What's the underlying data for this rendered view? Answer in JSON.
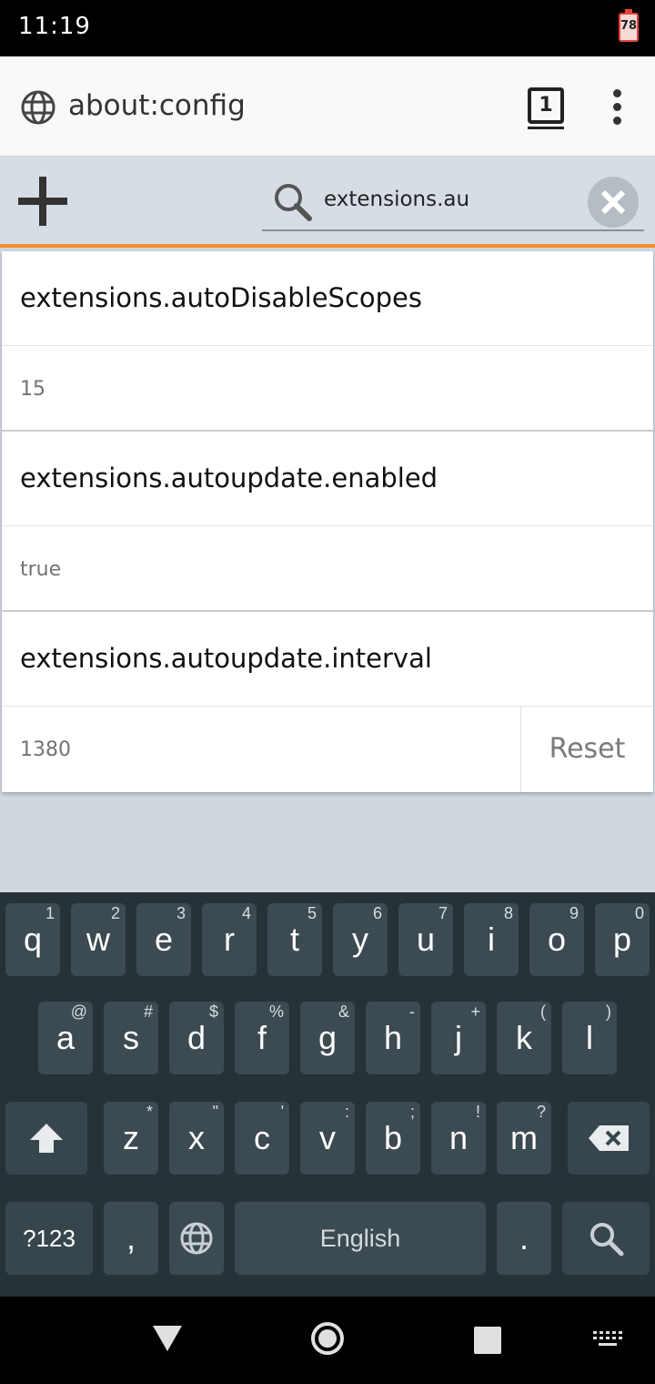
{
  "status_bar": {
    "time": "11:19",
    "battery": "78"
  },
  "browser": {
    "url": "about:config",
    "tab_count": "1",
    "icons": {
      "site": "globe-icon",
      "menu": "overflow-menu-icon"
    }
  },
  "toolbar": {
    "search_query": "extensions.au",
    "icons": {
      "add": "plus-icon",
      "search": "search-icon",
      "clear": "close-icon"
    }
  },
  "prefs": [
    {
      "name": "extensions.autoDisableScopes",
      "value": "15"
    },
    {
      "name": "extensions.autoupdate.enabled",
      "value": "true"
    },
    {
      "name": "extensions.autoupdate.interval",
      "value": "1380",
      "action": "Reset"
    }
  ],
  "keyboard": {
    "row1": [
      {
        "k": "q",
        "h": "1"
      },
      {
        "k": "w",
        "h": "2"
      },
      {
        "k": "e",
        "h": "3"
      },
      {
        "k": "r",
        "h": "4"
      },
      {
        "k": "t",
        "h": "5"
      },
      {
        "k": "y",
        "h": "6"
      },
      {
        "k": "u",
        "h": "7"
      },
      {
        "k": "i",
        "h": "8"
      },
      {
        "k": "o",
        "h": "9"
      },
      {
        "k": "p",
        "h": "0"
      }
    ],
    "row2": [
      {
        "k": "a",
        "h": "@"
      },
      {
        "k": "s",
        "h": "#"
      },
      {
        "k": "d",
        "h": "$"
      },
      {
        "k": "f",
        "h": "%"
      },
      {
        "k": "g",
        "h": "&"
      },
      {
        "k": "h",
        "h": "-"
      },
      {
        "k": "j",
        "h": "+"
      },
      {
        "k": "k",
        "h": "("
      },
      {
        "k": "l",
        "h": ")"
      }
    ],
    "row3": [
      {
        "k": "z",
        "h": "*"
      },
      {
        "k": "x",
        "h": "\""
      },
      {
        "k": "c",
        "h": "'"
      },
      {
        "k": "v",
        "h": ":"
      },
      {
        "k": "b",
        "h": ";"
      },
      {
        "k": "n",
        "h": "!"
      },
      {
        "k": "m",
        "h": "?"
      }
    ],
    "symbols_label": "?123",
    "comma": ",",
    "space_label": "English",
    "period": "."
  }
}
